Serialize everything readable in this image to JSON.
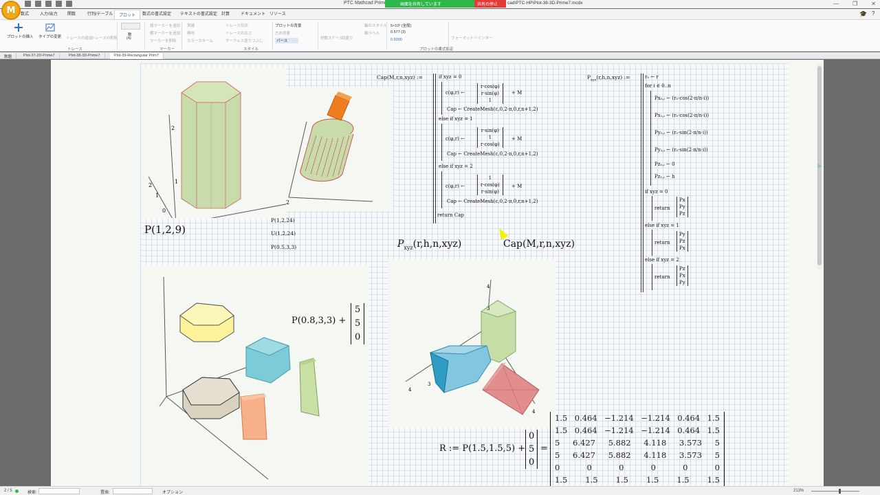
{
  "window": {
    "app_title": "PTC Mathcad Prime 7.0",
    "share_status": "画面を共有しています",
    "stop_share": "共有の停止",
    "file_path": "cad\\PTC-HP\\Plot-38-3D-Prime7.mcdx"
  },
  "ribbon_tabs": [
    "数式",
    "入力/出力",
    "関数",
    "行列/テーブル",
    "プロット",
    "数式の書式設定",
    "テキストの書式設定",
    "計算",
    "ドキュメント",
    "リソース"
  ],
  "active_tab": "プロット",
  "ribbon": {
    "insert_plot": "プロットの挿入",
    "change_type": "タイプの変更",
    "trace_group": "トレース",
    "marker_group": "マーカー",
    "style_group": "スタイル",
    "format_group": "プロットの書式設定",
    "count_label": "数",
    "count_value": "(4)",
    "add_vertical_marker": "縦マーカーを追加",
    "add_horizontal_marker": "横マーカーを追加",
    "delete_marker": "マーカーを削除",
    "solid": "実線",
    "none": "無地",
    "color_scheme": "カラースキーム",
    "trace_style": "トレース形状",
    "trace_thickness": "トレースの太さ",
    "surface_fill": "サーフェス塗りつぶし",
    "plot_background": "プロットの背景",
    "custom_background": "方向背景",
    "perspective": "パース",
    "log_scale": "対数スケール",
    "tick_marks": "目盛り",
    "axis_format": "軸のスタイル",
    "axis_labels": "軸ラベル",
    "number_format": "5×10³ (全般)",
    "number_value": "0.577 (3)",
    "number_sample": "0.5000",
    "format_painter": "フォーマットペインター"
  },
  "doc_tabs": [
    "数題",
    "Plot-37-2D-Prime7",
    "Plot-38-3D-Prime7",
    "Plot-39-Rectangular Prim7"
  ],
  "active_doc": "Plot-39-Rectangular Prim7",
  "worksheet": {
    "label_P129": "P(1,2,9)",
    "plot1_exprs": [
      "P(1,2,24)",
      "U(1,2,24)",
      "P(0.5,3,3)"
    ],
    "cap_def_header": "Cap(M,r,n,xyz) :=",
    "p_def_header": "P",
    "p_def_sub": "xyz",
    "p_def_args": "(r,h,n,xyz) :=",
    "cap_lines": {
      "if0": "if  xyz = 0",
      "c0_lhs": "c(φ,r) ←",
      "c0_vec": [
        "r·cos(φ)",
        "r·sin(φ)",
        "1"
      ],
      "c0_rhs": "+ M",
      "cap0": "Cap ← CreateMesh(c,0,2·π,0,r,n+1,2)",
      "if1": "else if  xyz = 1",
      "c1_vec": [
        "r·sin(φ)",
        "1",
        "r·cos(φ)"
      ],
      "cap1": "Cap ← CreateMesh(c,0,2·π,0,r,n+1,2)",
      "if2": "else if  xyz = 2",
      "c2_vec": [
        "1",
        "r·cos(φ)",
        "r·sin(φ)"
      ],
      "cap2": "Cap ← CreateMesh(c,0,2·π,0,r,n+1,2)",
      "ret": "return  Cap"
    },
    "p_lines": {
      "r0": "r₀ ← r",
      "for": "for  i ∈ 0‥n",
      "px0": "Px₀,ᵢ ← (r₀·cos(2·π/n·i))",
      "px1": "Px₁,ᵢ ← (r₀·cos(2·π/n·i))",
      "py0": "Py₀,ᵢ ← (r₀·sin(2·π/n·i))",
      "py1": "Py₁,ᵢ ← (r₀·sin(2·π/n·i))",
      "pz0": "Pz₀,ᵢ ← 0",
      "pz1": "Pz₁,ᵢ ← h",
      "if0": "if  xyz = 0",
      "ret0": [
        "Px",
        "Py",
        "Pz"
      ],
      "if1": "else if  xyz = 1",
      "ret1": [
        "Py",
        "Pz",
        "Px"
      ],
      "if2": "else if  xyz = 2",
      "ret2": [
        "Pz",
        "Px",
        "Py"
      ],
      "return": "return"
    },
    "collapsed_p": "P",
    "collapsed_p_sub": "xyz",
    "collapsed_p_args": "(r,h,n,xyz)",
    "collapsed_cap": "Cap(M,r,n,xyz)",
    "p0833_expr": "P(0.8,3,3) +",
    "p0833_vec": [
      "5",
      "5",
      "0"
    ],
    "r_def": "R := P(1.5,1.5,5) +",
    "r_vec": [
      "0",
      "5",
      "0"
    ],
    "r_equals": "=",
    "r_matrix": [
      [
        "1.5",
        "0.464",
        "−1.214",
        "−1.214",
        "0.464",
        "1.5"
      ],
      [
        "1.5",
        "0.464",
        "−1.214",
        "−1.214",
        "0.464",
        "1.5"
      ],
      [
        "5",
        "6.427",
        "5.882",
        "4.118",
        "3.573",
        "5"
      ],
      [
        "5",
        "6.427",
        "5.882",
        "4.118",
        "3.573",
        "5"
      ],
      [
        "0",
        "0",
        "0",
        "0",
        "0",
        "0"
      ],
      [
        "1.5",
        "1.5",
        "1.5",
        "1.5",
        "1.5",
        "1.5"
      ]
    ],
    "plot2_ticks": [
      "2",
      "1",
      "0",
      "1",
      "2"
    ],
    "plot3_ticks": [
      "2"
    ],
    "plot5_ticks": [
      "4",
      "3",
      "4",
      "3",
      "4"
    ]
  },
  "statusbar": {
    "page": "2 / 5",
    "search_label": "検索:",
    "replace_label": "置換:",
    "options": "オプション",
    "zoom": "213%"
  }
}
